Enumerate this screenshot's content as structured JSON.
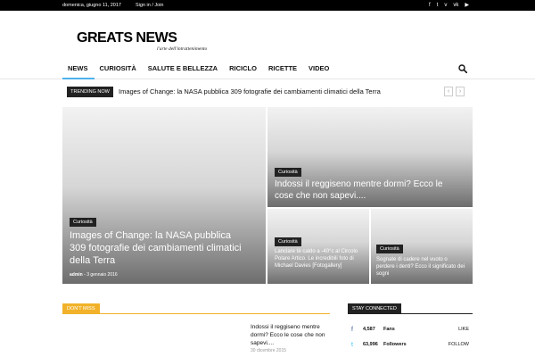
{
  "topbar": {
    "date": "domenica, giugno 11, 2017",
    "signin": "Sign in / Join",
    "social_icons": [
      "facebook-icon",
      "twitter-icon",
      "vimeo-icon",
      "vk-icon",
      "youtube-icon"
    ],
    "social_glyphs": [
      "f",
      "t",
      "v",
      "vk",
      "▶"
    ]
  },
  "logo": {
    "name": "GREATS NEWS",
    "tagline": "l'arte dell'intrattenimento"
  },
  "nav": {
    "items": [
      "NEWS",
      "CURIOSITÀ",
      "SALUTE E BELLEZZA",
      "RICICLO",
      "RICETTE",
      "VIDEO"
    ],
    "active_index": 0,
    "search_icon": "search-icon"
  },
  "trending": {
    "badge": "TRENDING NOW",
    "headline": "Images of Change: la NASA pubblica 309 fotografie dei cambiamenti climatici della Terra",
    "prev": "‹",
    "next": "›"
  },
  "tiles": {
    "main": {
      "category": "Curiosità",
      "title": "Images of Change: la NASA pubblica 309 fotografie dei cambiamenti climatici della Terra",
      "author": "admin",
      "separator": "-",
      "date": "3 gennaio 2016"
    },
    "top_right": {
      "category": "Curiosità",
      "title": "Indossi il reggiseno mentre dormi? Ecco le cose che non sapevi...."
    },
    "bottom_left": {
      "category": "Curiosità",
      "title": "Lanciare tè caldo a -40°c al Circolo Polare Artico. Le incredibili foto di Michael Davies [Fotogallery]"
    },
    "bottom_right": {
      "category": "Curiosità",
      "title": "Sognate di cadere nel vuoto o perdere i denti? Ecco il significato dei sogni"
    }
  },
  "dont_miss": {
    "label": "DON'T MISS",
    "story_title": "Indossi il reggiseno mentre dormi? Ecco le cose che non sapevi....",
    "story_date": "30 dicembre 2015"
  },
  "stay_connected": {
    "label": "STAY CONNECTED",
    "rows": [
      {
        "icon": "facebook-icon",
        "glyph": "f",
        "count": "4,587",
        "label": "Fans",
        "action": "LIKE",
        "color": "#3b5998"
      },
      {
        "icon": "twitter-icon",
        "glyph": "t",
        "count": "63,996",
        "label": "Followers",
        "action": "FOLLOW",
        "color": "#29c5f6"
      }
    ]
  },
  "colors": {
    "accent": "#4db2ec",
    "dont_miss": "#f1b22a",
    "facebook": "#3b5998",
    "twitter": "#29c5f6"
  }
}
